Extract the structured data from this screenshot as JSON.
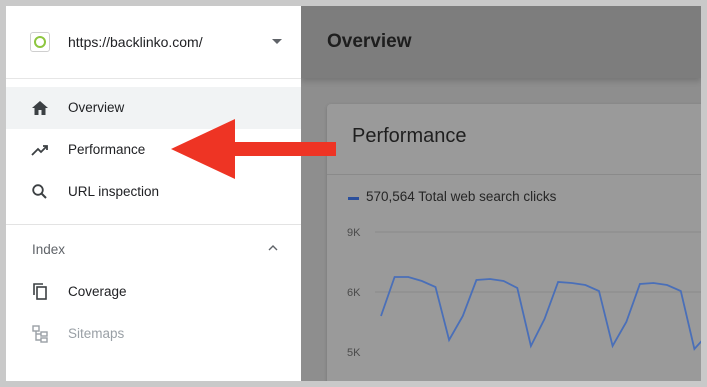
{
  "property": {
    "url": "https://backlinko.com/"
  },
  "sidebar": {
    "items": [
      {
        "label": "Overview",
        "icon": "home-icon"
      },
      {
        "label": "Performance",
        "icon": "trending-up-icon"
      },
      {
        "label": "URL inspection",
        "icon": "search-icon"
      }
    ],
    "section": {
      "label": "Index"
    },
    "index_items": [
      {
        "label": "Coverage",
        "icon": "copy-icon"
      },
      {
        "label": "Sitemaps",
        "icon": "sitemap-icon"
      }
    ]
  },
  "main": {
    "title": "Overview",
    "card": {
      "title": "Performance",
      "legend": "570,564 Total web search clicks"
    }
  },
  "chart_data": {
    "type": "line",
    "y_ticks": [
      "9K",
      "6K",
      "5K"
    ],
    "series": [
      {
        "values": [
          5600,
          6750,
          6750,
          6550,
          6250,
          5200,
          5600,
          6600,
          6650,
          6550,
          6200,
          5100,
          5550,
          6500,
          6450,
          6350,
          6050,
          5100,
          5500,
          6400,
          6450,
          6350,
          6050,
          5050,
          5300
        ]
      }
    ],
    "ylim": [
      5000,
      9000
    ],
    "color": "#4a6fb8"
  },
  "colors": {
    "arrow": "#ee3424",
    "overlay": "#8e8e8e",
    "accent_green": "#8dc63f"
  }
}
